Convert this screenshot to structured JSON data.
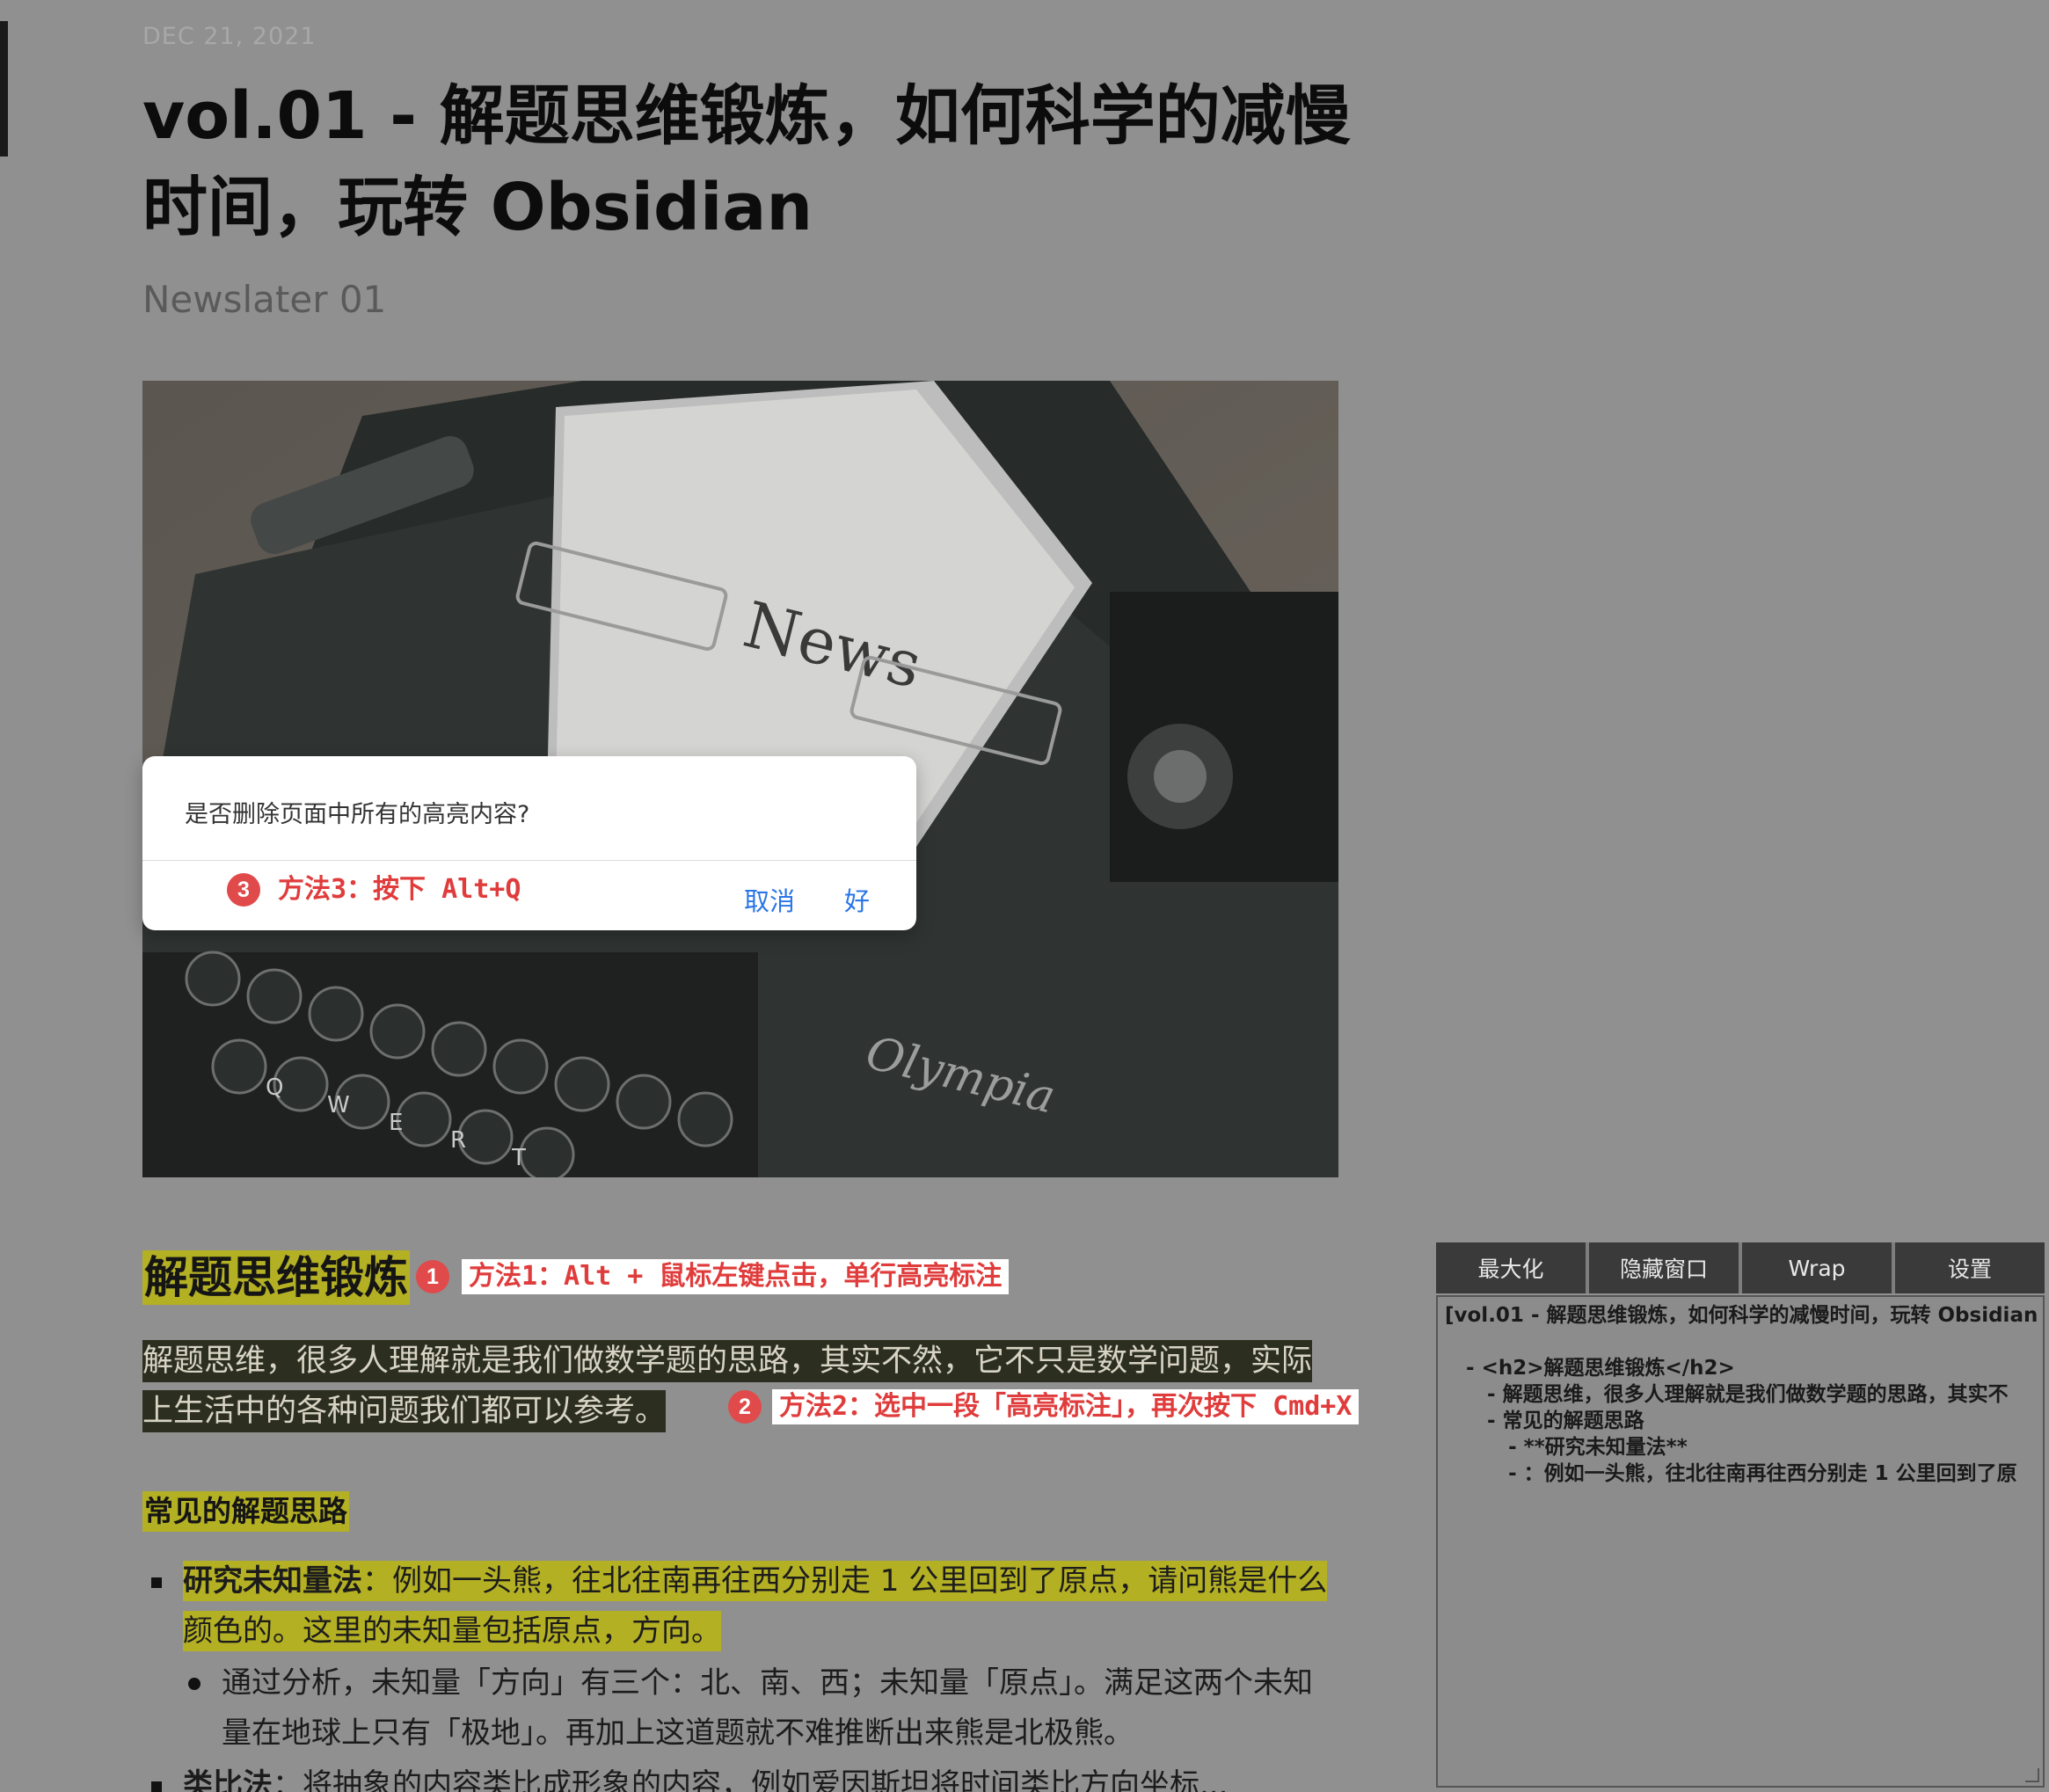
{
  "article": {
    "date": "DEC 21, 2021",
    "title": "vol.01 - 解题思维锻炼，如何科学的减慢时间，玩转 Obsidian",
    "subtitle": "Newslater 01",
    "hero_caption_news": "News",
    "hero_caption_brand": "Olympia",
    "section_heading": "解题思维锻炼",
    "paragraph": "解题思维，很多人理解就是我们做数学题的思路，其实不然，它不只是数学问题，实际上生活中的各种问题我们都可以参考。",
    "subheading": "常见的解题思路",
    "list": {
      "item1_bold": "研究未知量法",
      "item1_text": "：例如一头熊，往北往南再往西分别走 1 公里回到了原点，请问熊是什么颜色的。这里的未知量包括原点，方向。",
      "item1_sub": "通过分析，未知量「方向」有三个：北、南、西；未知量「原点」。满足这两个未知量在地球上只有「极地」。再加上这道题就不难推断出来熊是北极熊。",
      "item2_bold": "类比法",
      "item2_text": "：将抽象的内容类比成形象的内容，例如爱因斯坦将时间类比方向坐标..."
    }
  },
  "dialog": {
    "message": "是否删除页面中所有的高亮内容?",
    "cancel": "取消",
    "ok": "好"
  },
  "annotations": {
    "n1": "1",
    "note1": "方法1：Alt + 鼠标左键点击，单行高亮标注",
    "n2": "2",
    "note2": "方法2：选中一段「高亮标注」，再次按下 Cmd+X",
    "n3": "3",
    "note3": "方法3：按下 Alt+Q"
  },
  "panel": {
    "buttons": [
      "最大化",
      "隐藏窗口",
      "Wrap",
      "设置"
    ],
    "text": "[vol.01 - 解题思维锻炼，如何科学的减慢时间，玩转 Obsidian\n\n   - <h2>解题思维锻炼</h2>\n      - 解题思维，很多人理解就是我们做数学题的思路，其实不\n      - 常见的解题思路\n         - **研究未知量法**\n         - ：例如一头熊，往北往南再往西分别走 1 公里回到了原"
  },
  "colors": {
    "highlight": "#b4b024",
    "annotation_red": "#e03c3c",
    "dialog_button_blue": "#2a76e8"
  }
}
